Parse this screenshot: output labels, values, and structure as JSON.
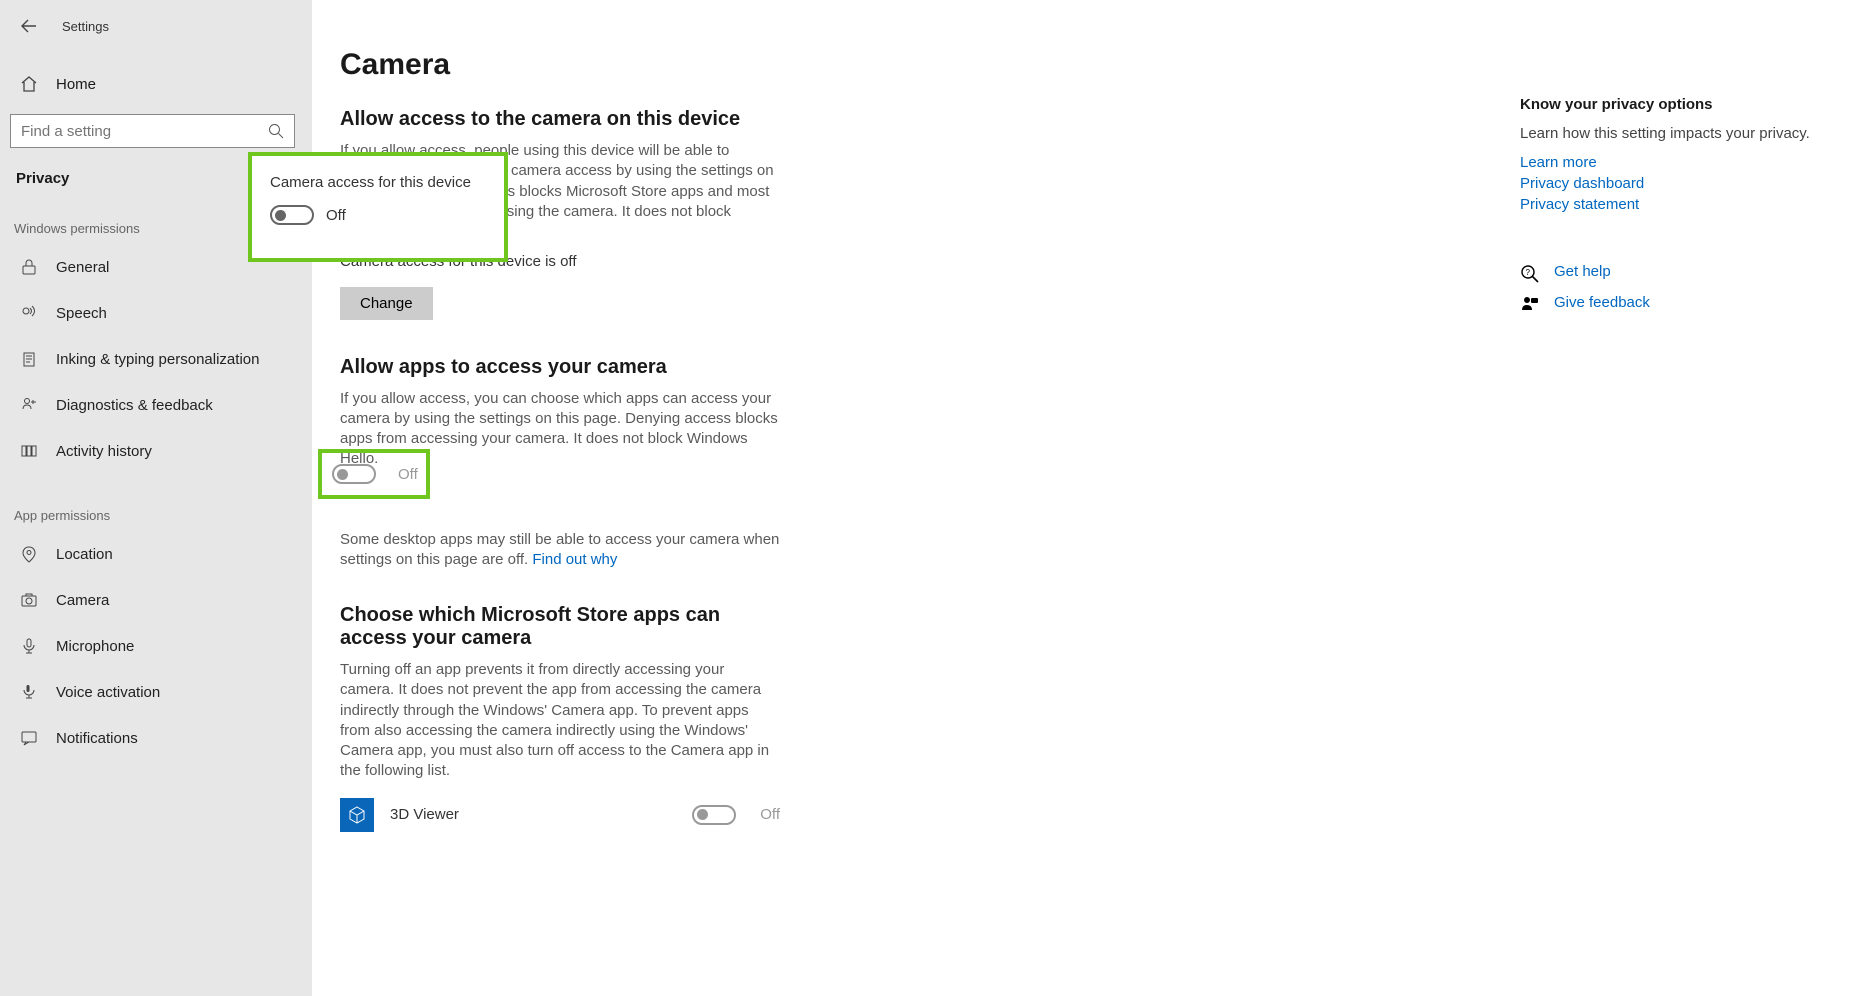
{
  "window": {
    "title": "Settings"
  },
  "sidebar": {
    "home": "Home",
    "search_placeholder": "Find a setting",
    "category": "Privacy",
    "section1_header": "Windows permissions",
    "section1": [
      {
        "label": "General"
      },
      {
        "label": "Speech"
      },
      {
        "label": "Inking & typing personalization"
      },
      {
        "label": "Diagnostics & feedback"
      },
      {
        "label": "Activity history"
      }
    ],
    "section2_header": "App permissions",
    "section2": [
      {
        "label": "Location"
      },
      {
        "label": "Camera"
      },
      {
        "label": "Microphone"
      },
      {
        "label": "Voice activation"
      },
      {
        "label": "Notifications"
      }
    ]
  },
  "main": {
    "title": "Camera",
    "sec1_h": "Allow access to the camera on this device",
    "sec1_p": "If you allow access, people using this device will be able to choose if their apps have camera access by using the settings on this page. Denying access blocks Microsoft Store apps and most desktop apps from accessing the camera. It does not block Windows Hello.",
    "sec1_status": "Camera access for this device is off",
    "change_btn": "Change",
    "sec2_h": "Allow apps to access your camera",
    "sec2_p": "If you allow access, you can choose which apps can access your camera by using the settings on this page. Denying access blocks apps from accessing your camera. It does not block Windows Hello.",
    "sec2_toggle": "Off",
    "sec2_note_a": "Some desktop apps may still be able to access your camera when settings on this page are off. ",
    "sec2_note_link": "Find out why",
    "sec3_h": "Choose which Microsoft Store apps can access your camera",
    "sec3_p": "Turning off an app prevents it from directly accessing your camera. It does not prevent the app from accessing the camera indirectly through the Windows' Camera app. To prevent apps from also accessing the camera indirectly using the Windows' Camera app, you must also turn off access to the Camera app in the following list.",
    "app1": {
      "name": "3D Viewer",
      "state": "Off"
    }
  },
  "popup": {
    "title": "Camera access for this device",
    "state": "Off"
  },
  "right": {
    "h": "Know your privacy options",
    "p": "Learn how this setting impacts your privacy.",
    "links": [
      "Learn more",
      "Privacy dashboard",
      "Privacy statement"
    ],
    "help": "Get help",
    "feedback": "Give feedback"
  }
}
